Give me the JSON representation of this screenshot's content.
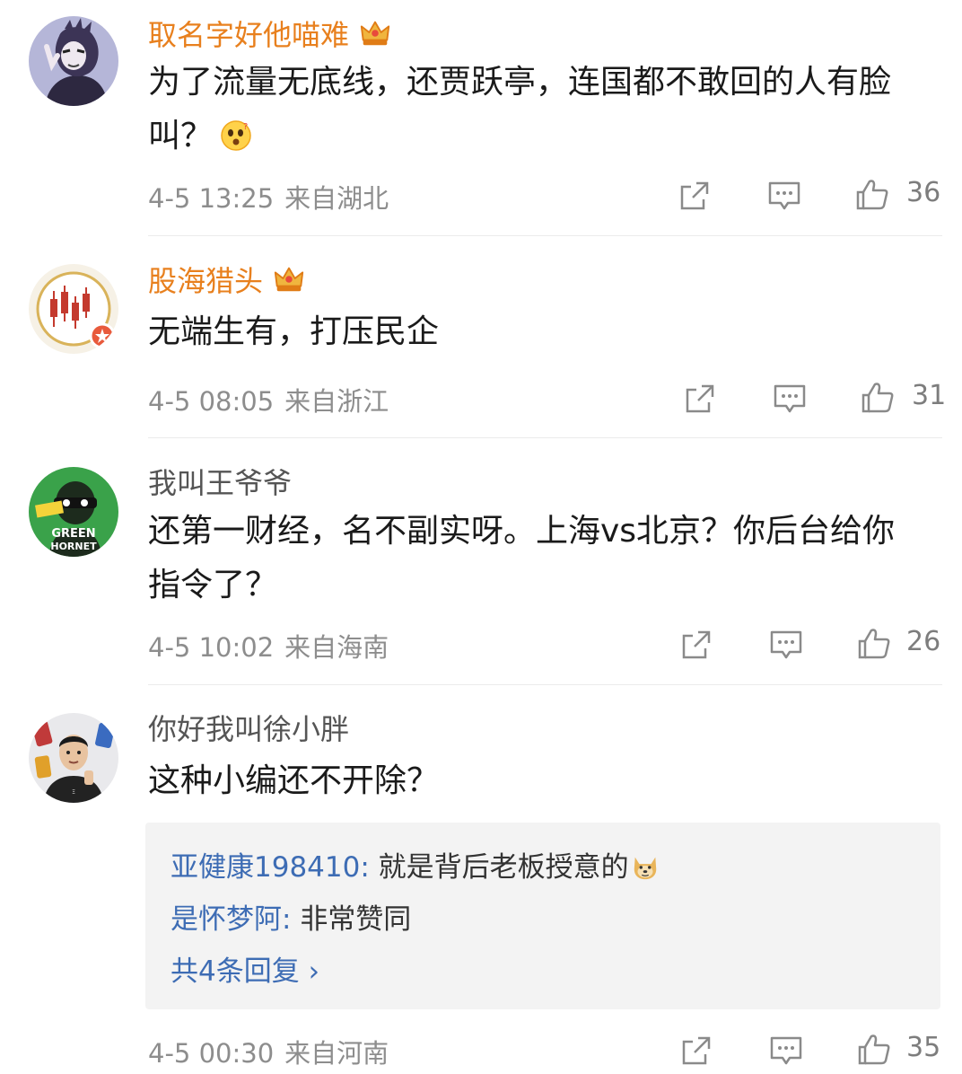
{
  "comments": [
    {
      "username": "取名字好他喵难",
      "vip": true,
      "text": "为了流量无底线，还贾跃亭，连国都不敢回的人有脸叫？",
      "emoji": "surprised-emoji",
      "time": "4-5 13:25",
      "location": "来自湖北",
      "likes": "36"
    },
    {
      "username": "股海猎头",
      "vip": true,
      "text": "无端生有，打压民企",
      "time": "4-5 08:05",
      "location": "来自浙江",
      "likes": "31"
    },
    {
      "username": "我叫王爷爷",
      "vip": false,
      "text": "还第一财经，名不副实呀。上海vs北京？你后台给你指令了？",
      "time": "4-5 10:02",
      "location": "来自海南",
      "likes": "26"
    },
    {
      "username": "你好我叫徐小胖",
      "vip": false,
      "text": "这种小编还不开除？",
      "time": "4-5 00:30",
      "location": "来自河南",
      "likes": "35",
      "replies": [
        {
          "user": "亚健康198410",
          "text": "就是背后老板授意的",
          "emoji": "doge-emoji"
        },
        {
          "user": "是怀梦阿",
          "text": "非常赞同"
        }
      ],
      "more_replies": "共4条回复 ›"
    }
  ],
  "colors": {
    "vip_name": "#e8801e",
    "normal_name": "#555555",
    "reply_user": "#3d6cb4",
    "meta_text": "#8d8d8d",
    "reply_bg": "#f3f3f3"
  },
  "icons": {
    "actions": [
      "share-icon",
      "comment-icon",
      "thumbs-up-icon"
    ],
    "vip": "crown-icon"
  }
}
